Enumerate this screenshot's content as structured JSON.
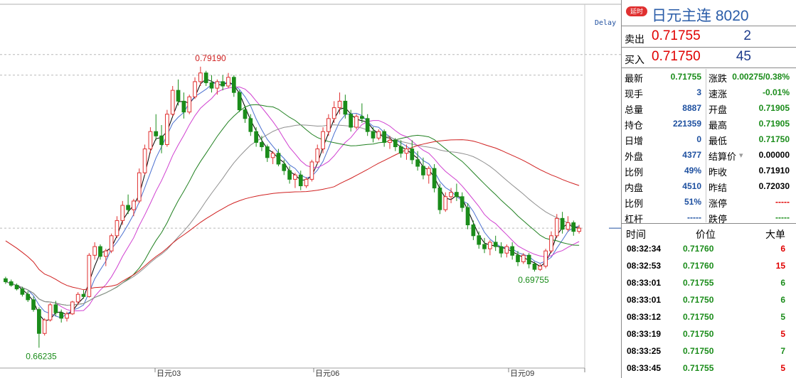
{
  "chart_data": {
    "type": "candlestick",
    "ylim": [
      0.655,
      0.82
    ],
    "delay_label": "Delay",
    "x_ticks": [
      "日元03",
      "日元06",
      "日元09"
    ],
    "annotations": [
      {
        "label": "0.79190",
        "value": 0.7919
      },
      {
        "label": "0.66235",
        "value": 0.66235
      },
      {
        "label": "0.69755",
        "value": 0.69755
      }
    ],
    "reference_lines": [
      0.7975,
      0.788,
      0.7175
    ],
    "candles": [
      [
        0.6942,
        0.6951,
        0.6918,
        0.6928
      ],
      [
        0.6928,
        0.6938,
        0.6905,
        0.6912
      ],
      [
        0.6912,
        0.692,
        0.6888,
        0.6895
      ],
      [
        0.6895,
        0.6905,
        0.686,
        0.687
      ],
      [
        0.687,
        0.6885,
        0.6835,
        0.6845
      ],
      [
        0.6845,
        0.686,
        0.679,
        0.68
      ],
      [
        0.68,
        0.681,
        0.6624,
        0.669
      ],
      [
        0.669,
        0.676,
        0.668,
        0.6752
      ],
      [
        0.6752,
        0.683,
        0.6745,
        0.6822
      ],
      [
        0.6822,
        0.684,
        0.677,
        0.6785
      ],
      [
        0.6785,
        0.68,
        0.674,
        0.676
      ],
      [
        0.676,
        0.679,
        0.6745,
        0.678
      ],
      [
        0.678,
        0.684,
        0.6775,
        0.6835
      ],
      [
        0.6835,
        0.688,
        0.682,
        0.687
      ],
      [
        0.687,
        0.689,
        0.685,
        0.686
      ],
      [
        0.686,
        0.706,
        0.6855,
        0.705
      ],
      [
        0.705,
        0.711,
        0.703,
        0.709
      ],
      [
        0.709,
        0.71,
        0.703,
        0.7045
      ],
      [
        0.7045,
        0.708,
        0.7,
        0.707
      ],
      [
        0.707,
        0.715,
        0.706,
        0.714
      ],
      [
        0.714,
        0.723,
        0.713,
        0.721
      ],
      [
        0.721,
        0.73,
        0.719,
        0.728
      ],
      [
        0.728,
        0.733,
        0.724,
        0.726
      ],
      [
        0.726,
        0.731,
        0.723,
        0.73
      ],
      [
        0.73,
        0.745,
        0.729,
        0.743
      ],
      [
        0.743,
        0.756,
        0.742,
        0.754
      ],
      [
        0.754,
        0.764,
        0.752,
        0.762
      ],
      [
        0.762,
        0.77,
        0.758,
        0.76
      ],
      [
        0.76,
        0.765,
        0.752,
        0.756
      ],
      [
        0.756,
        0.772,
        0.755,
        0.77
      ],
      [
        0.77,
        0.783,
        0.769,
        0.781
      ],
      [
        0.781,
        0.786,
        0.774,
        0.776
      ],
      [
        0.776,
        0.78,
        0.768,
        0.771
      ],
      [
        0.771,
        0.779,
        0.77,
        0.778
      ],
      [
        0.778,
        0.787,
        0.777,
        0.785
      ],
      [
        0.785,
        0.7919,
        0.783,
        0.789
      ],
      [
        0.789,
        0.79,
        0.783,
        0.7845
      ],
      [
        0.7845,
        0.788,
        0.78,
        0.782
      ],
      [
        0.782,
        0.786,
        0.779,
        0.785
      ],
      [
        0.785,
        0.788,
        0.781,
        0.783
      ],
      [
        0.783,
        0.789,
        0.782,
        0.787
      ],
      [
        0.787,
        0.788,
        0.778,
        0.78
      ],
      [
        0.78,
        0.781,
        0.771,
        0.772
      ],
      [
        0.772,
        0.774,
        0.766,
        0.768
      ],
      [
        0.768,
        0.77,
        0.76,
        0.762
      ],
      [
        0.762,
        0.764,
        0.755,
        0.757
      ],
      [
        0.757,
        0.76,
        0.753,
        0.755
      ],
      [
        0.755,
        0.756,
        0.748,
        0.75
      ],
      [
        0.75,
        0.753,
        0.747,
        0.752
      ],
      [
        0.752,
        0.754,
        0.746,
        0.747
      ],
      [
        0.747,
        0.749,
        0.742,
        0.744
      ],
      [
        0.744,
        0.746,
        0.738,
        0.74
      ],
      [
        0.74,
        0.743,
        0.736,
        0.742
      ],
      [
        0.742,
        0.744,
        0.735,
        0.737
      ],
      [
        0.737,
        0.741,
        0.736,
        0.74
      ],
      [
        0.74,
        0.749,
        0.739,
        0.748
      ],
      [
        0.748,
        0.756,
        0.747,
        0.754
      ],
      [
        0.754,
        0.764,
        0.752,
        0.762
      ],
      [
        0.762,
        0.77,
        0.76,
        0.768
      ],
      [
        0.768,
        0.776,
        0.766,
        0.773
      ],
      [
        0.773,
        0.78,
        0.77,
        0.776
      ],
      [
        0.776,
        0.779,
        0.768,
        0.77
      ],
      [
        0.77,
        0.772,
        0.762,
        0.764
      ],
      [
        0.764,
        0.77,
        0.763,
        0.769
      ],
      [
        0.769,
        0.775,
        0.766,
        0.768
      ],
      [
        0.768,
        0.77,
        0.76,
        0.762
      ],
      [
        0.762,
        0.764,
        0.757,
        0.759
      ],
      [
        0.759,
        0.763,
        0.758,
        0.762
      ],
      [
        0.762,
        0.763,
        0.755,
        0.757
      ],
      [
        0.757,
        0.76,
        0.754,
        0.758
      ],
      [
        0.758,
        0.759,
        0.753,
        0.755
      ],
      [
        0.755,
        0.758,
        0.75,
        0.752
      ],
      [
        0.752,
        0.756,
        0.749,
        0.754
      ],
      [
        0.754,
        0.758,
        0.747,
        0.749
      ],
      [
        0.749,
        0.753,
        0.744,
        0.746
      ],
      [
        0.746,
        0.75,
        0.74,
        0.742
      ],
      [
        0.742,
        0.746,
        0.738,
        0.745
      ],
      [
        0.745,
        0.747,
        0.734,
        0.736
      ],
      [
        0.736,
        0.738,
        0.724,
        0.726
      ],
      [
        0.726,
        0.734,
        0.725,
        0.732
      ],
      [
        0.732,
        0.736,
        0.729,
        0.734
      ],
      [
        0.734,
        0.738,
        0.73,
        0.732
      ],
      [
        0.732,
        0.734,
        0.725,
        0.727
      ],
      [
        0.727,
        0.729,
        0.717,
        0.719
      ],
      [
        0.719,
        0.721,
        0.712,
        0.714
      ],
      [
        0.714,
        0.716,
        0.708,
        0.71
      ],
      [
        0.71,
        0.713,
        0.706,
        0.708
      ],
      [
        0.708,
        0.712,
        0.705,
        0.711
      ],
      [
        0.711,
        0.714,
        0.707,
        0.709
      ],
      [
        0.709,
        0.711,
        0.704,
        0.706
      ],
      [
        0.706,
        0.71,
        0.704,
        0.709
      ],
      [
        0.709,
        0.711,
        0.703,
        0.705
      ],
      [
        0.705,
        0.707,
        0.7,
        0.702
      ],
      [
        0.702,
        0.706,
        0.701,
        0.705
      ],
      [
        0.705,
        0.706,
        0.699,
        0.701
      ],
      [
        0.701,
        0.702,
        0.6975,
        0.6985
      ],
      [
        0.6985,
        0.701,
        0.6978,
        0.7
      ],
      [
        0.7,
        0.708,
        0.699,
        0.707
      ],
      [
        0.707,
        0.716,
        0.706,
        0.714
      ],
      [
        0.714,
        0.724,
        0.713,
        0.722
      ],
      [
        0.722,
        0.725,
        0.715,
        0.717
      ],
      [
        0.717,
        0.723,
        0.716,
        0.72
      ],
      [
        0.72,
        0.721,
        0.714,
        0.716
      ],
      [
        0.716,
        0.719,
        0.715,
        0.7175
      ]
    ],
    "moving_averages": [
      {
        "color": "#000000"
      },
      {
        "color": "#4a6fd0"
      },
      {
        "color": "#d040d0"
      },
      {
        "color": "#208020"
      },
      {
        "color": "#909090"
      },
      {
        "color": "#d02020"
      }
    ]
  },
  "panel": {
    "badge": "延时",
    "title": "日元主连 8020",
    "sell_label": "卖出",
    "sell_price": "0.71755",
    "sell_vol": "2",
    "buy_label": "买入",
    "buy_price": "0.71750",
    "buy_vol": "45",
    "stats": [
      {
        "l": "最新",
        "lv": "0.71755",
        "lc": "green",
        "r": "涨跌",
        "rv": "0.00275/0.38%",
        "rc": "green"
      },
      {
        "l": "现手",
        "lv": "3",
        "lc": "blue",
        "r": "速涨",
        "rv": "-0.01%",
        "rc": "green"
      },
      {
        "l": "总量",
        "lv": "8887",
        "lc": "blue",
        "r": "开盘",
        "rv": "0.71905",
        "rc": "green"
      },
      {
        "l": "持仓",
        "lv": "221359",
        "lc": "blue",
        "r": "最高",
        "rv": "0.71905",
        "rc": "green"
      },
      {
        "l": "日增",
        "lv": "0",
        "lc": "blue",
        "r": "最低",
        "rv": "0.71750",
        "rc": "green"
      },
      {
        "l": "外盘",
        "lv": "4377",
        "lc": "blue",
        "r": "结算价",
        "rv": "0.00000",
        "rc": "black"
      },
      {
        "l": "比例",
        "lv": "49%",
        "lc": "blue",
        "r": "昨收",
        "rv": "0.71910",
        "rc": "black"
      },
      {
        "l": "内盘",
        "lv": "4510",
        "lc": "blue",
        "r": "昨结",
        "rv": "0.72030",
        "rc": "black"
      },
      {
        "l": "比例",
        "lv": "51%",
        "lc": "blue",
        "r": "涨停",
        "rv": "-----",
        "rc": "red"
      },
      {
        "l": "杠杆",
        "lv": "-----",
        "lc": "blue",
        "r": "跌停",
        "rv": "-----",
        "rc": "green"
      }
    ],
    "ticks_header": {
      "time": "时间",
      "price": "价位",
      "vol": "大单"
    },
    "ticks": [
      {
        "time": "08:32:34",
        "price": "0.71760",
        "vol": "6",
        "vc": "red"
      },
      {
        "time": "08:32:53",
        "price": "0.71760",
        "vol": "15",
        "vc": "red"
      },
      {
        "time": "08:33:01",
        "price": "0.71755",
        "vol": "6",
        "vc": "green"
      },
      {
        "time": "08:33:01",
        "price": "0.71750",
        "vol": "6",
        "vc": "green"
      },
      {
        "time": "08:33:12",
        "price": "0.71750",
        "vol": "5",
        "vc": "green"
      },
      {
        "time": "08:33:19",
        "price": "0.71750",
        "vol": "5",
        "vc": "red"
      },
      {
        "time": "08:33:25",
        "price": "0.71750",
        "vol": "7",
        "vc": "green"
      },
      {
        "time": "08:33:45",
        "price": "0.71755",
        "vol": "5",
        "vc": "red"
      }
    ]
  }
}
